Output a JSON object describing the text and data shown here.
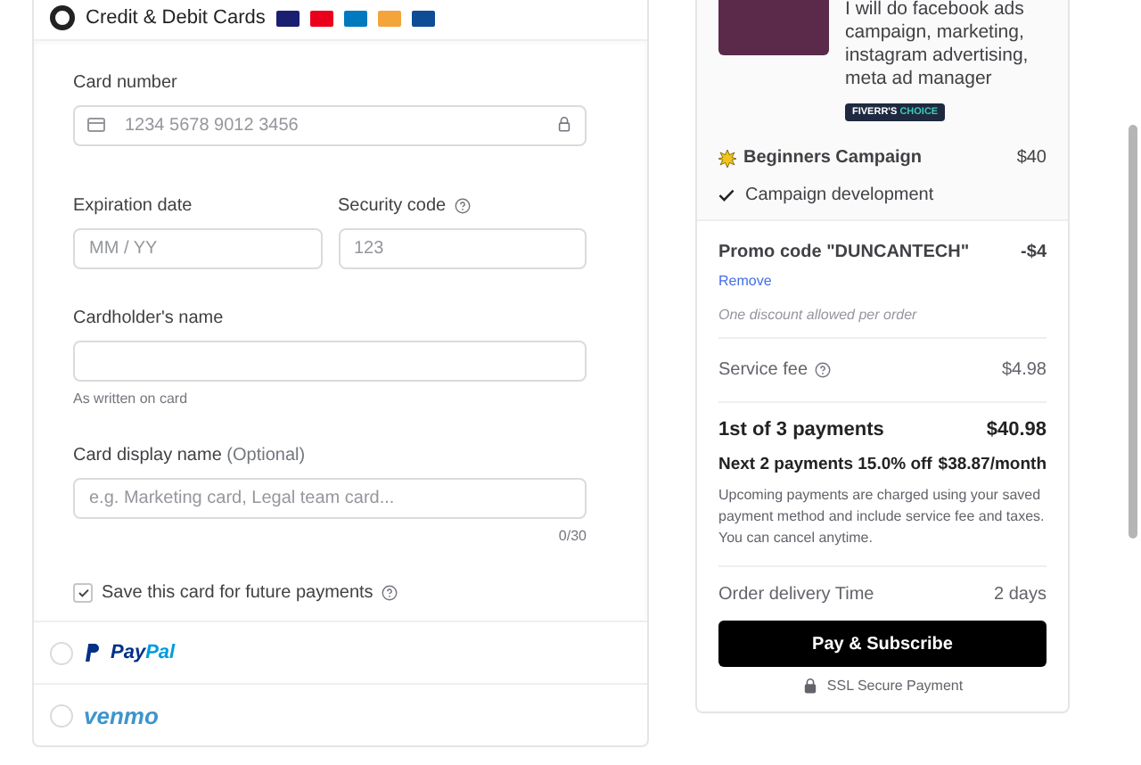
{
  "payment_methods": [
    {
      "kind": "card",
      "label": "Credit & Debit Cards",
      "selected": true
    },
    {
      "kind": "paypal",
      "logo_parts": [
        "Pay",
        "Pal"
      ],
      "selected": false
    },
    {
      "kind": "venmo",
      "logo_parts": [
        "venmo"
      ],
      "selected": false
    }
  ],
  "card_form": {
    "card_number": {
      "label": "Card number",
      "placeholder": "1234 5678 9012 3456"
    },
    "expiration": {
      "label": "Expiration date",
      "placeholder": "MM / YY"
    },
    "security_code": {
      "label": "Security code",
      "placeholder": "123"
    },
    "cardholder": {
      "label": "Cardholder's name",
      "hint": "As written on card"
    },
    "display_name": {
      "label": "Card display name",
      "optional": "(Optional)",
      "placeholder": "e.g. Marketing card, Legal team card...",
      "counter": "0/30"
    },
    "save_card": {
      "label": "Save this card for future payments",
      "checked": true
    }
  },
  "order_summary": {
    "gig_title": "I will do facebook ads campaign, marketing, instagram advertising, meta ad manager",
    "badge_parts": [
      "FIVERR'S",
      "CHOICE"
    ],
    "package": {
      "name": "Beginners Campaign",
      "price": "$40",
      "features": [
        "Campaign development"
      ]
    },
    "promo": {
      "label": "Promo code \"DUNCANTECH\"",
      "amount": "-$4",
      "remove": "Remove",
      "note": "One discount allowed per order"
    },
    "service_fee": {
      "label": "Service fee",
      "amount": "$4.98"
    },
    "first_payment": {
      "label": "1st of 3 payments",
      "amount": "$40.98"
    },
    "next_payments": {
      "label": "Next 2 payments 15.0% off",
      "amount": "$38.87/month"
    },
    "payment_note": "Upcoming payments are charged using your saved payment method and include service fee and taxes. You can cancel anytime.",
    "delivery": {
      "label": "Order delivery Time",
      "value": "2 days"
    },
    "button": "Pay & Subscribe",
    "secure": "SSL Secure Payment"
  }
}
